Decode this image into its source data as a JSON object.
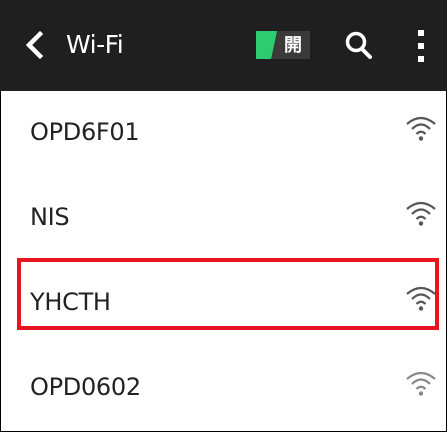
{
  "app_bar": {
    "title": "Wi-Fi",
    "toggle_label": "開",
    "toggle_color": "#2ecc71",
    "back_icon": "chevron-left-icon",
    "search_icon": "search-icon",
    "more_icon": "more-vert-icon"
  },
  "networks": [
    {
      "ssid": "OPD6F01",
      "signal_icon": "wifi-signal-icon"
    },
    {
      "ssid": "NIS",
      "signal_icon": "wifi-signal-icon"
    },
    {
      "ssid": "YHCTH",
      "signal_icon": "wifi-signal-icon",
      "highlighted": true
    },
    {
      "ssid": "OPD0602",
      "signal_icon": "wifi-signal-icon"
    }
  ],
  "colors": {
    "app_bar": "#1f1f1f",
    "highlight": "#e8141e"
  }
}
